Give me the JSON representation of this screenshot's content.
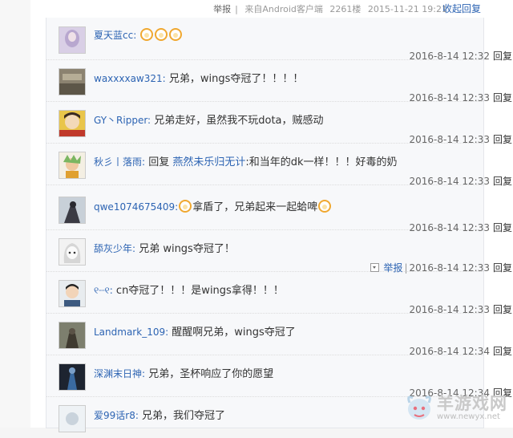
{
  "post_meta": {
    "report": "举报",
    "source": "来自Android客户端",
    "floor": "2261楼",
    "datetime": "2015-11-21 19:21",
    "collapse_label": "收起回复",
    "separator": "|"
  },
  "replies": [
    {
      "user": "夏天蓝cc:",
      "text": "",
      "emojis": 3,
      "time": "2016-8-14 12:32",
      "reply_label": "回复"
    },
    {
      "user": "waxxxxaw321:",
      "text": "兄弟，wings夺冠了！！！！",
      "time": "2016-8-14 12:33",
      "reply_label": "回复"
    },
    {
      "user": "GY丶Ripper:",
      "text": "兄弟走好，虽然我不玩dota，贼感动",
      "time": "2016-8-14 12:33",
      "reply_label": "回复"
    },
    {
      "user": "秋彡丨落雨:",
      "prefix": "回复",
      "quote": "燕然未乐归无计",
      "text": ":和当年的dk一样！！！好毒的奶",
      "time": "2016-8-14 12:33",
      "reply_label": "回复"
    },
    {
      "user": "qwe1074675409:",
      "text_before": "",
      "text": "拿盾了，兄弟起来一起蛤啤",
      "time": "2016-8-14 12:33",
      "reply_label": "回复"
    },
    {
      "user": "舔灰少年:",
      "text": "兄弟 wings夺冠了！",
      "report": "举报",
      "separator": "|",
      "time": "2016-8-14 12:33",
      "reply_label": "回复"
    },
    {
      "user": "୧┈୧:",
      "text": "cn夺冠了！！！是wings拿得！！！",
      "time": "2016-8-14 12:33",
      "reply_label": "回复"
    },
    {
      "user": "Landmark_109:",
      "text": "醒醒啊兄弟，wings夺冠了",
      "time": "2016-8-14 12:34",
      "reply_label": "回复"
    },
    {
      "user": "深渊末日神:",
      "text": "兄弟，圣杯响应了你的愿望",
      "time": "2016-8-14 12:34",
      "reply_label": "回复"
    },
    {
      "user": "爱99话r8:",
      "text": "兄弟，我们夺冠了",
      "time": "",
      "reply_label": ""
    }
  ],
  "watermark": {
    "title": "羊游戏网",
    "url": "www.newyx.net"
  }
}
